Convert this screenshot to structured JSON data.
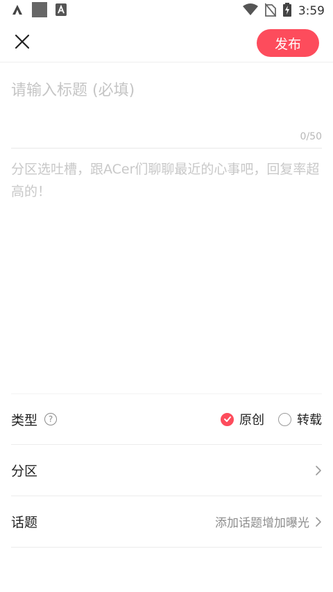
{
  "status_bar": {
    "time": "3:59",
    "left_icons": [
      "app-logo-icon",
      "square-notification-icon",
      "font-app-icon"
    ],
    "right_icons": [
      "wifi-icon",
      "no-sim-icon",
      "battery-charging-icon"
    ]
  },
  "app_bar": {
    "publish_label": "发布",
    "accent_color": "#fd4c5c"
  },
  "editor": {
    "title_placeholder": "请输入标题 (必填)",
    "title_value": "",
    "counter": "0/50",
    "content_placeholder": "分区选吐槽，跟ACer们聊聊最近的心事吧，回复率超高的！",
    "content_value": ""
  },
  "options": {
    "type_label": "类型",
    "type_options": [
      {
        "label": "原创",
        "checked": true
      },
      {
        "label": "转载",
        "checked": false
      }
    ],
    "section_label": "分区",
    "topic_label": "话题",
    "topic_value": "添加话题增加曝光"
  }
}
